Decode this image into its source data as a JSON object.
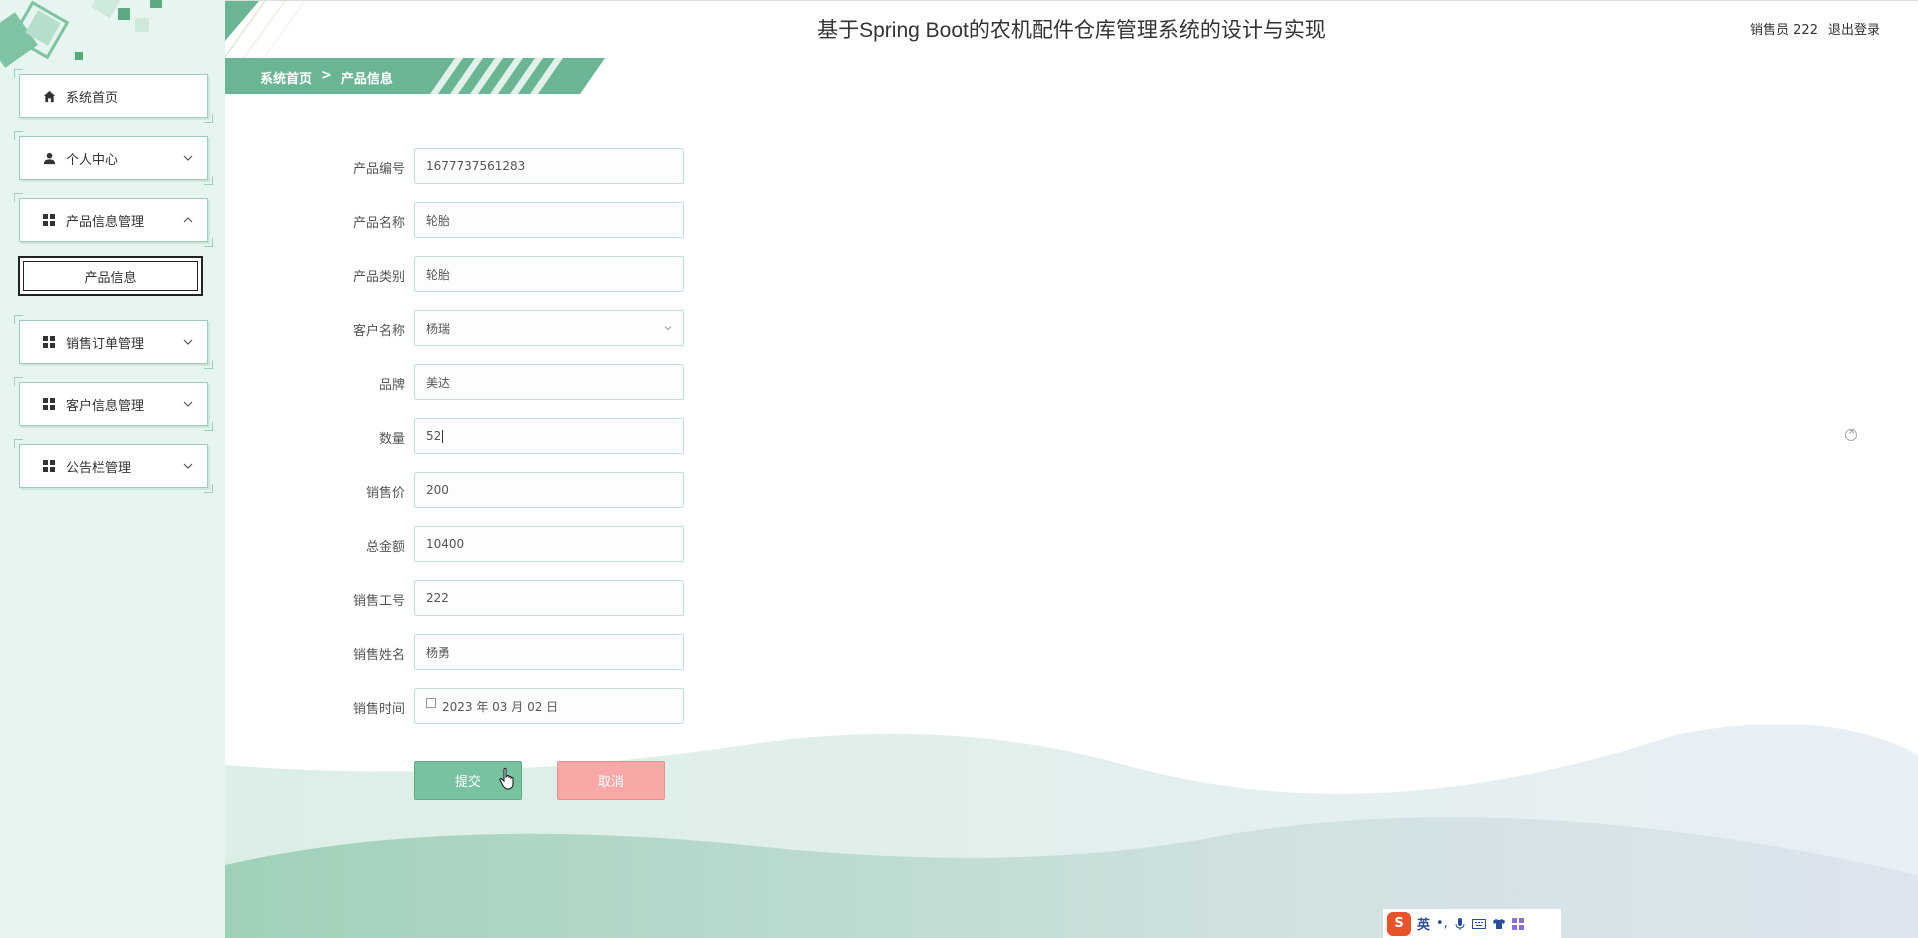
{
  "header": {
    "title": "基于Spring Boot的农机配件仓库管理系统的设计与实现",
    "user_label": "销售员 222",
    "logout_label": "退出登录"
  },
  "breadcrumb": {
    "home": "系统首页",
    "separator": ">",
    "current": "产品信息"
  },
  "sidebar": {
    "items": [
      {
        "label": "系统首页",
        "icon": "home-icon"
      },
      {
        "label": "个人中心",
        "icon": "user-icon"
      },
      {
        "label": "产品信息管理",
        "icon": "grid-icon"
      },
      {
        "label": "销售订单管理",
        "icon": "grid-icon"
      },
      {
        "label": "客户信息管理",
        "icon": "grid-icon"
      },
      {
        "label": "公告栏管理",
        "icon": "grid-icon"
      }
    ],
    "sub_item": "产品信息"
  },
  "form": {
    "fields": [
      {
        "label": "产品编号",
        "value": "1677737561283"
      },
      {
        "label": "产品名称",
        "value": "轮胎"
      },
      {
        "label": "产品类别",
        "value": "轮胎"
      },
      {
        "label": "客户名称",
        "value": "杨瑞"
      },
      {
        "label": "品牌",
        "value": "美达"
      },
      {
        "label": "数量",
        "value": "52"
      },
      {
        "label": "销售价",
        "value": "200"
      },
      {
        "label": "总金额",
        "value": "10400"
      },
      {
        "label": "销售工号",
        "value": "222"
      },
      {
        "label": "销售姓名",
        "value": "杨勇"
      },
      {
        "label": "销售时间",
        "value": "2023 年 03 月 02 日"
      }
    ],
    "submit_label": "提交",
    "cancel_label": "取消"
  },
  "ime": {
    "mode": "英"
  },
  "colors": {
    "accent": "#6ab593",
    "sidebar_bg": "#e6f5ef",
    "cancel": "#f9a8a8"
  }
}
